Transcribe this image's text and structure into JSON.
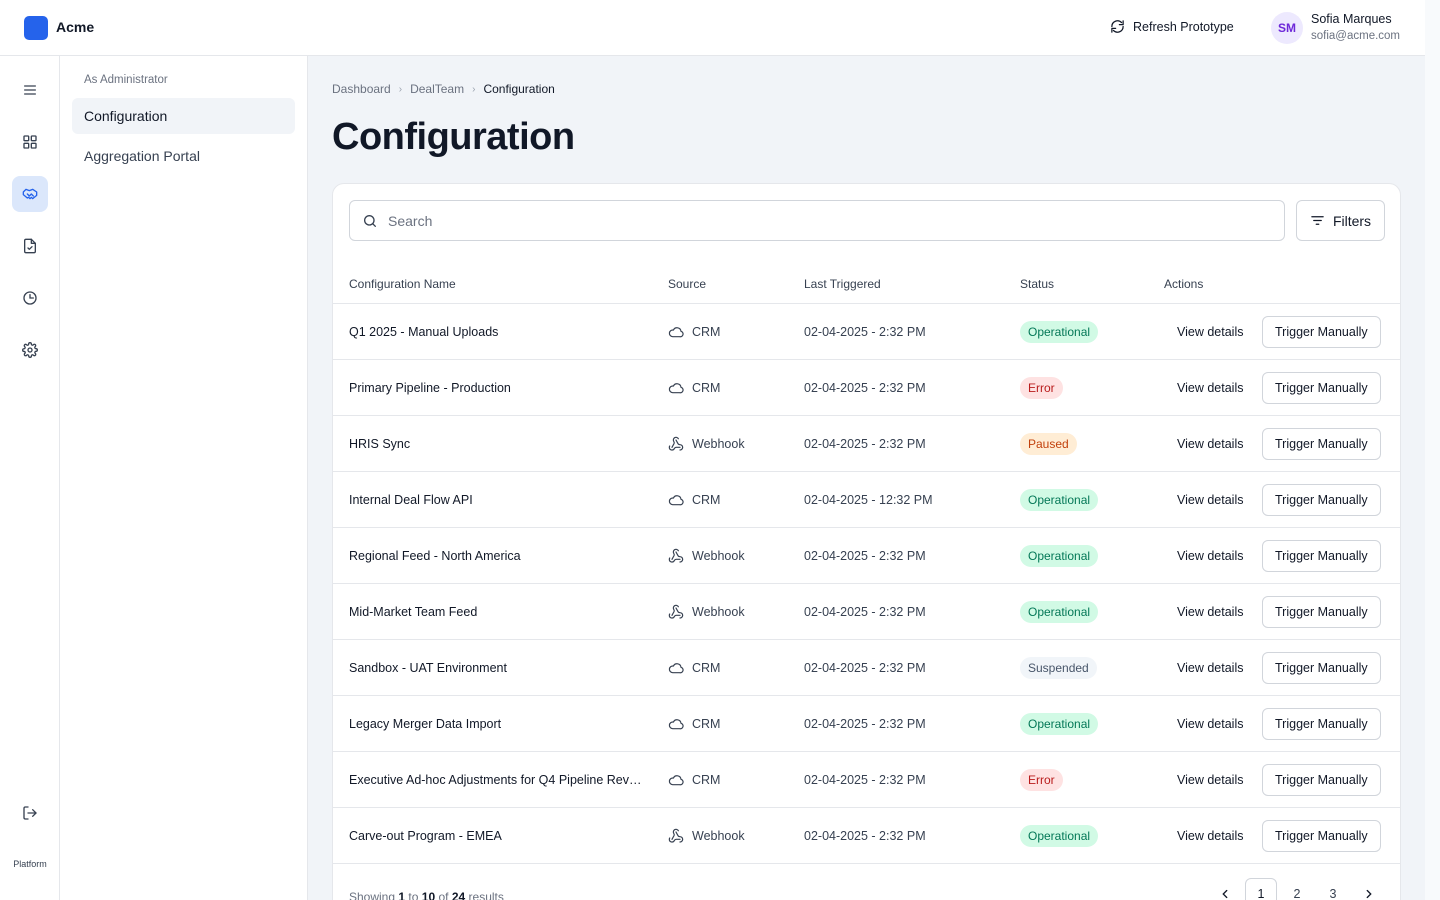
{
  "app": {
    "name": "Acme"
  },
  "header": {
    "refresh_label": "Refresh Prototype",
    "user": {
      "initials": "SM",
      "name": "Sofia Marques",
      "email": "sofia@acme.com"
    }
  },
  "rail": {
    "items": [
      {
        "icon": "menu-icon"
      },
      {
        "icon": "dashboard-grid-icon"
      },
      {
        "icon": "handshake-icon",
        "active": true
      },
      {
        "icon": "document-icon"
      },
      {
        "icon": "clock-icon"
      },
      {
        "icon": "gear-icon"
      }
    ],
    "logout_icon": "logout-icon",
    "label": "Platform"
  },
  "subnav": {
    "heading": "As Administrator",
    "items": [
      {
        "label": "Configuration",
        "active": true
      },
      {
        "label": "Aggregation Portal",
        "active": false
      }
    ]
  },
  "breadcrumb": [
    "Dashboard",
    "DealTeam",
    "Configuration"
  ],
  "page_title": "Configuration",
  "search": {
    "placeholder": "Search"
  },
  "filters_label": "Filters",
  "table": {
    "columns": [
      "Configuration Name",
      "Source",
      "Last Triggered",
      "Status",
      "Actions"
    ],
    "rows": [
      {
        "name": "Q1 2025 - Manual Uploads",
        "source": "CRM",
        "source_icon": "cloud-icon",
        "time": "02-04-2025 - 2:32 PM",
        "status": "Operational",
        "status_color": "#047857"
      },
      {
        "name": "Primary Pipeline - Production",
        "source": "CRM",
        "source_icon": "cloud-icon",
        "time": "02-04-2025 - 2:32 PM",
        "status": "Error",
        "status_color": "#b91c1c"
      },
      {
        "name": "HRIS Sync",
        "source": "Webhook",
        "source_icon": "webhook-icon",
        "time": "02-04-2025 - 2:32 PM",
        "status": "Paused",
        "status_color": "#c2410c"
      },
      {
        "name": "Internal Deal Flow API",
        "source": "CRM",
        "source_icon": "cloud-icon",
        "time": "02-04-2025 - 12:32 PM",
        "status": "Operational",
        "status_color": "#047857"
      },
      {
        "name": "Regional Feed - North America",
        "source": "Webhook",
        "source_icon": "webhook-icon",
        "time": "02-04-2025 - 2:32 PM",
        "status": "Operational",
        "status_color": "#047857"
      },
      {
        "name": "Mid-Market Team Feed",
        "source": "Webhook",
        "source_icon": "webhook-icon",
        "time": "02-04-2025 - 2:32 PM",
        "status": "Operational",
        "status_color": "#047857"
      },
      {
        "name": "Sandbox - UAT Environment",
        "source": "CRM",
        "source_icon": "cloud-icon",
        "time": "02-04-2025 - 2:32 PM",
        "status": "Suspended",
        "status_color": "#475569"
      },
      {
        "name": "Legacy Merger Data Import",
        "source": "CRM",
        "source_icon": "cloud-icon",
        "time": "02-04-2025 - 2:32 PM",
        "status": "Operational",
        "status_color": "#047857"
      },
      {
        "name": "Executive Ad-hoc Adjustments for Q4 Pipeline Revie...",
        "source": "CRM",
        "source_icon": "cloud-icon",
        "time": "02-04-2025 - 2:32 PM",
        "status": "Error",
        "status_color": "#b91c1c"
      },
      {
        "name": "Carve-out Program - EMEA",
        "source": "Webhook",
        "source_icon": "webhook-icon",
        "time": "02-04-2025 - 2:32 PM",
        "status": "Operational",
        "status_color": "#047857"
      }
    ],
    "view_label": "View details",
    "trigger_label": "Trigger Manually"
  },
  "footer": {
    "showing_word": "Showing",
    "from": "1",
    "to_word": "to",
    "to": "10",
    "of_word": "of",
    "total": "24",
    "results_word": "results"
  },
  "pagination": {
    "pages": [
      "1",
      "2",
      "3"
    ],
    "current": "1"
  },
  "colors": {
    "accent": "#2563eb",
    "active_nav": "#dbe7fb"
  }
}
